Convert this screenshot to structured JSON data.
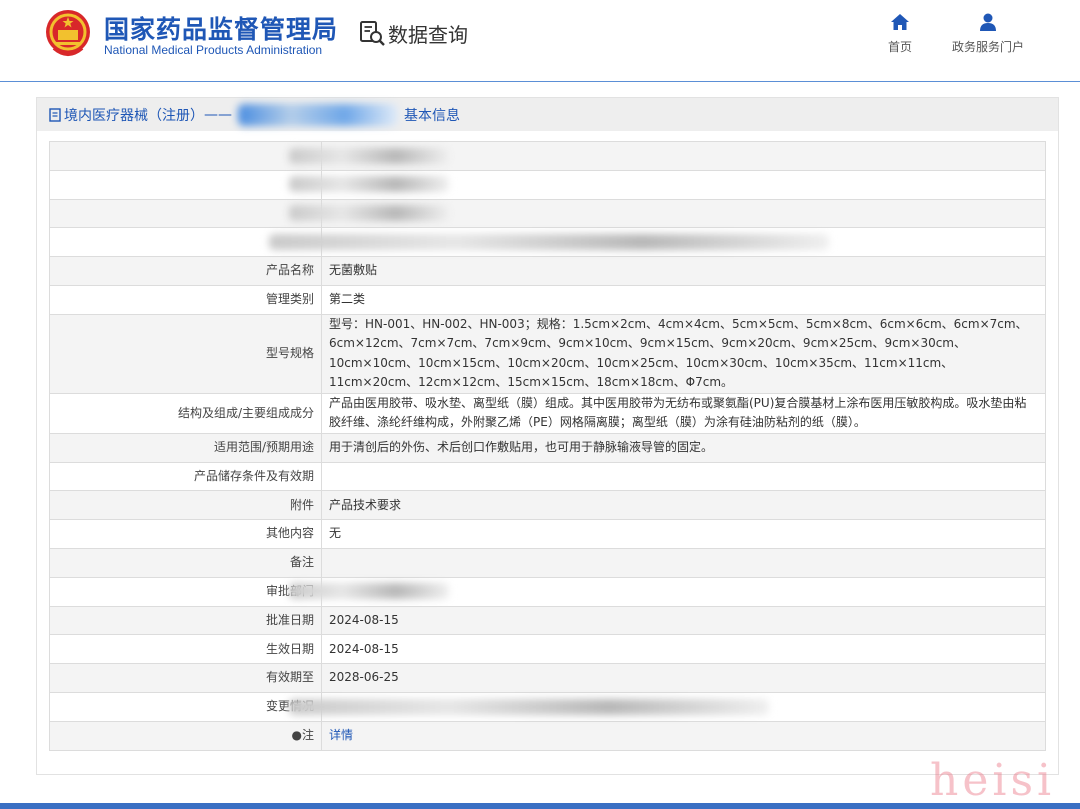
{
  "header": {
    "brand_cn": "国家药品监督管理局",
    "brand_en": "National Medical Products Administration",
    "query_label": "数据查询",
    "nav": [
      {
        "label": "首页",
        "icon": "home-icon"
      },
      {
        "label": "政务服务门户",
        "icon": "user-icon"
      }
    ],
    "accent_color": "#1f57b6"
  },
  "panel": {
    "title_prefix": "境内医疗器械（注册）",
    "title_suffix": "基本信息"
  },
  "rows": [
    {
      "label": "",
      "value": "",
      "redacted": true
    },
    {
      "label": "",
      "value": "",
      "redacted": true
    },
    {
      "label": "",
      "value": "",
      "redacted": true
    },
    {
      "label": "",
      "value": "",
      "redacted": true
    },
    {
      "label": "产品名称",
      "value": "无菌敷贴"
    },
    {
      "label": "管理类别",
      "value": "第二类"
    },
    {
      "label": "型号规格",
      "value": "型号：HN-001、HN-002、HN-003；规格：1.5cm×2cm、4cm×4cm、5cm×5cm、5cm×8cm、6cm×6cm、6cm×7cm、6cm×12cm、7cm×7cm、7cm×9cm、9cm×10cm、9cm×15cm、9cm×20cm、9cm×25cm、9cm×30cm、10cm×10cm、10cm×15cm、10cm×20cm、10cm×25cm、10cm×30cm、10cm×35cm、11cm×11cm、11cm×20cm、12cm×12cm、15cm×15cm、18cm×18cm、Φ7cm。"
    },
    {
      "label": "结构及组成/主要组成成分",
      "value": "产品由医用胶带、吸水垫、离型纸（膜）组成。其中医用胶带为无纺布或聚氨酯(PU)复合膜基材上涂布医用压敏胶构成。吸水垫由粘胶纤维、涤纶纤维构成，外附聚乙烯（PE）网格隔离膜；离型纸（膜）为涂有硅油防粘剂的纸（膜）。"
    },
    {
      "label": "适用范围/预期用途",
      "value": "用于清创后的外伤、术后创口作敷贴用，也可用于静脉输液导管的固定。"
    },
    {
      "label": "产品储存条件及有效期",
      "value": ""
    },
    {
      "label": "附件",
      "value": "产品技术要求"
    },
    {
      "label": "其他内容",
      "value": "无"
    },
    {
      "label": "备注",
      "value": ""
    },
    {
      "label": "审批部门",
      "value": "",
      "redacted": true
    },
    {
      "label": "批准日期",
      "value": "2024-08-15"
    },
    {
      "label": "生效日期",
      "value": "2024-08-15"
    },
    {
      "label": "有效期至",
      "value": "2028-06-25"
    },
    {
      "label": "变更情况",
      "value": "",
      "redacted": true
    },
    {
      "label": "●注",
      "value": "详情",
      "link": true
    }
  ],
  "watermark": "heisi"
}
